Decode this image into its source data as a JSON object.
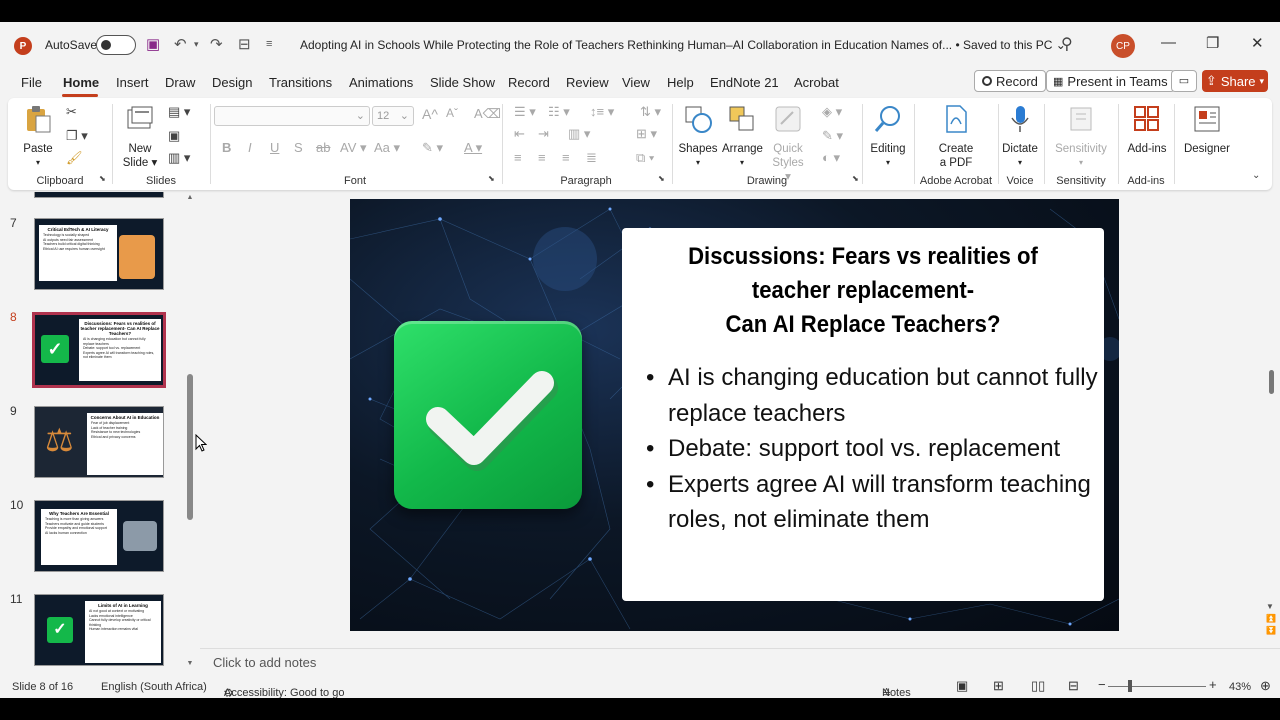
{
  "app": {
    "logo": "P",
    "autosave_label": "AutoSave",
    "autosave_state": "Off",
    "document_title": "Adopting AI in Schools While Protecting the Role of Teachers Rethinking Human–AI Collaboration in Education Names of...",
    "save_status": "•  Saved to this PC",
    "user_initials": "CP"
  },
  "menu": {
    "tabs": [
      "File",
      "Home",
      "Insert",
      "Draw",
      "Design",
      "Transitions",
      "Animations",
      "Slide Show",
      "Record",
      "Review",
      "View",
      "Help",
      "EndNote 21",
      "Acrobat"
    ],
    "active_tab": "Home",
    "record_label": "Record",
    "teams_label": "Present in Teams",
    "share_label": "Share"
  },
  "ribbon": {
    "clipboard": {
      "group": "Clipboard",
      "paste": "Paste"
    },
    "slides": {
      "group": "Slides",
      "new_slide_1": "New",
      "new_slide_2": "Slide"
    },
    "font": {
      "group": "Font",
      "font_size": "12"
    },
    "paragraph": {
      "group": "Paragraph"
    },
    "drawing": {
      "group": "Drawing",
      "shapes": "Shapes",
      "arrange": "Arrange",
      "quick_styles_1": "Quick",
      "quick_styles_2": "Styles"
    },
    "editing": {
      "label": "Editing"
    },
    "acrobat": {
      "group": "Adobe Acrobat",
      "create_pdf_1": "Create",
      "create_pdf_2": "a PDF"
    },
    "voice": {
      "group": "Voice",
      "dictate": "Dictate"
    },
    "sensitivity": {
      "group": "Sensitivity",
      "label": "Sensitivity"
    },
    "addins": {
      "group": "Add-ins",
      "label": "Add-ins"
    },
    "designer": {
      "label": "Designer"
    }
  },
  "thumbnails": [
    {
      "num": "7",
      "title": "Critical EdTech & AI Literacy",
      "lines": [
        "Technology is socially shaped",
        "AI outputs need fair assessment",
        "Teachers build critical digital thinking",
        "Ethical AI use requires human oversight"
      ]
    },
    {
      "num": "8",
      "title": "Discussions: Fears vs realities of teacher replacement- Can AI Replace Teachers?",
      "lines": [
        "AI is changing education but cannot fully replace teachers",
        "Debate: support tool vs. replacement",
        "Experts agree AI will transform teaching roles, not eliminate them"
      ]
    },
    {
      "num": "9",
      "title": "Concerns About AI in Education",
      "lines": [
        "Fear of job displacement",
        "Lack of teacher training",
        "Resistance to new technologies",
        "Ethical and privacy concerns"
      ]
    },
    {
      "num": "10",
      "title": "Why Teachers Are Essential",
      "lines": [
        "Teaching is more than giving answers",
        "Teachers motivate and guide students",
        "Provide empathy and emotional support",
        "AI lacks human connection"
      ]
    },
    {
      "num": "11",
      "title": "Limits of AI in Learning",
      "lines": [
        "AI not good at context or motivating",
        "Lacks emotional intelligence",
        "Cannot fully develop creativity or critical thinking",
        "Human interaction remains vital"
      ]
    }
  ],
  "slide": {
    "title_line1": "Discussions: Fears vs realities of",
    "title_line2": "teacher replacement-",
    "title_line3": "Can AI Replace Teachers?",
    "bullets": [
      "AI is changing education but cannot fully replace teachers",
      "Debate: support tool vs. replacement",
      "Experts agree AI will transform teaching roles, not eliminate them"
    ]
  },
  "notes": {
    "placeholder": "Click to add notes"
  },
  "status": {
    "slide_position": "Slide 8 of 16",
    "language": "English (South Africa)",
    "accessibility": "Accessibility: Good to go",
    "notes_label": "Notes",
    "zoom": "43%"
  },
  "colors": {
    "accent": "#c43e1c",
    "selected_thumb": "#b0334e",
    "check_green": "#14b84a"
  }
}
